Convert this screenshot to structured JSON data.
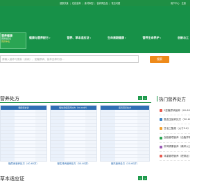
{
  "topbar": {
    "links": [
      "健康饮食",
      "在线营养",
      "食材库配",
      "营养周边品",
      "常见问题"
    ],
    "login": "用户中心",
    "register": "注册"
  },
  "logo": {
    "line1": "营养健康",
    "line2": "肥胖糖尿病",
    "line3": "营养体检"
  },
  "menu": [
    {
      "label": "健康与营养配方",
      "chevron": "▾"
    },
    {
      "label": "营养、草本适应证",
      "chevron": "▾"
    },
    {
      "label": "生命周期健康",
      "chevron": "▾"
    },
    {
      "label": "营养生命养护",
      "chevron": "▾"
    },
    {
      "label": "创新与工",
      "chevron": ""
    }
  ],
  "search": {
    "placeholder": "请输入营养与搜索（疾病），如糖尿病、营养品等内容...",
    "button": "搜索"
  },
  "section1": {
    "title": "营养处方",
    "prev": "‹",
    "next": "›"
  },
  "cards": [
    {
      "header": "糖尿病食谱",
      "caption": "糖尿病营养处方（40-60岁）"
    },
    {
      "header": "慢性肾病营养处方（50-60岁）",
      "caption": "慢性肾病营养处方（50-60岁）"
    },
    {
      "header": "痛风营养处方",
      "caption": "痛风营养处方（50-60岁）"
    }
  ],
  "sidebar": {
    "title": "热门营养处方",
    "items": [
      {
        "text": "2型糖尿病营养（40-60岁）",
        "color": "#e85a4f"
      },
      {
        "text": "高血压营养处方（50-60岁）",
        "color": "#3b82c4"
      },
      {
        "text": "甘油三酯高（大于5.6）",
        "color": "#f0a030"
      },
      {
        "text": "血脂管理营养（血脂异常）",
        "color": "#2aa553"
      },
      {
        "text": "肝肾健康营养（痛风以上）",
        "color": "#9b59b6"
      },
      {
        "text": "体重管理营养（肥胖症）",
        "color": "#e85a4f"
      }
    ]
  },
  "section2": {
    "title": "草本适应证",
    "prev": "‹",
    "next": "›"
  },
  "colors": {
    "brand_green": "#179148",
    "search_orange": "#ee8a1a",
    "card_blue": "#2f6fb5"
  }
}
